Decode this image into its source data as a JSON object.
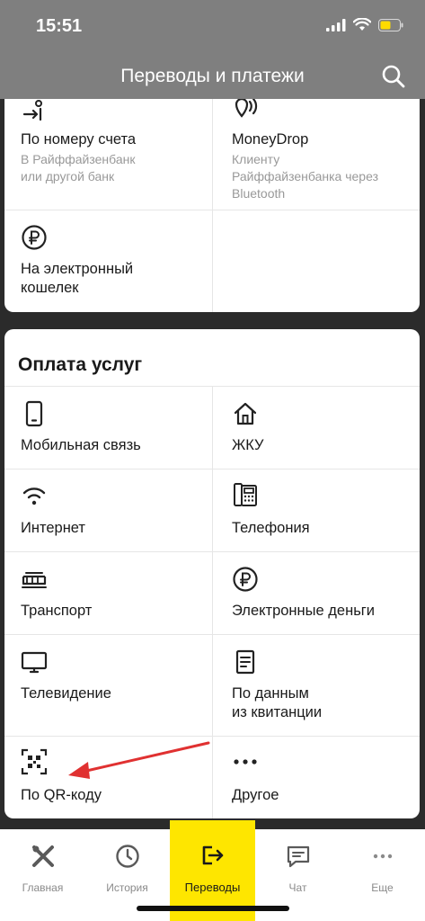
{
  "status_bar": {
    "time": "15:51"
  },
  "header": {
    "title": "Переводы и платежи"
  },
  "transfers": {
    "items": [
      {
        "label": "По номеру счета",
        "sub": "В Райффайзенбанк\nили другой банк"
      },
      {
        "label": "MoneyDrop",
        "sub": "Клиенту\nРайффайзенбанка через\nBluetooth"
      },
      {
        "label": "На электронный\nкошелек"
      }
    ]
  },
  "services": {
    "title": "Оплата услуг",
    "items": [
      {
        "label": "Мобильная связь"
      },
      {
        "label": "ЖКУ"
      },
      {
        "label": "Интернет"
      },
      {
        "label": "Телефония"
      },
      {
        "label": "Транспорт"
      },
      {
        "label": "Электронные деньги"
      },
      {
        "label": "Телевидение"
      },
      {
        "label": "По данным\nиз квитанции"
      },
      {
        "label": "По QR-коду"
      },
      {
        "label": "Другое"
      }
    ]
  },
  "nav": {
    "items": [
      {
        "label": "Главная"
      },
      {
        "label": "История"
      },
      {
        "label": "Переводы",
        "active": true
      },
      {
        "label": "Чат"
      },
      {
        "label": "Еще"
      }
    ]
  },
  "colors": {
    "accent": "#fee600",
    "annotation_arrow": "#e03131",
    "header_bg": "#7f7f7f"
  }
}
